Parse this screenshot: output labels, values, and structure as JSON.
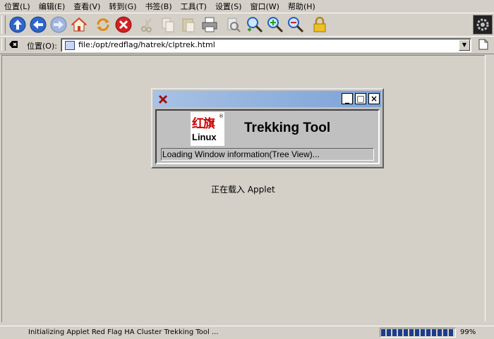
{
  "menu": [
    "位置(L)",
    "编辑(E)",
    "查看(V)",
    "转到(G)",
    "书签(B)",
    "工具(T)",
    "设置(S)",
    "窗口(W)",
    "帮助(H)"
  ],
  "toolbar": {
    "icons": [
      "up-arrow-icon",
      "back-arrow-icon",
      "forward-arrow-icon",
      "home-icon",
      "reload-icon",
      "stop-icon",
      "cut-icon",
      "copy-icon",
      "paste-icon",
      "print-icon",
      "print-preview-icon",
      "zoom-icon",
      "zoom-in-icon",
      "zoom-out-icon",
      "lock-icon"
    ]
  },
  "location": {
    "label": "位置(O):",
    "url": "file:/opt/redflag/hatrek/clptrek.html"
  },
  "splash": {
    "logo_cn": "红旗",
    "logo_reg": "®",
    "logo_linux": "Linux",
    "app_title": "Trekking Tool",
    "status": "Loading Window information(Tree View)...",
    "buttons": {
      "minimize": "_",
      "maximize": "□",
      "close": "×"
    }
  },
  "content": {
    "loading_message": "正在载入  Applet"
  },
  "statusbar": {
    "text": "Initializing Applet Red Flag HA Cluster Trekking Tool ...",
    "progress_percent": 99,
    "progress_label": "99%"
  },
  "colors": {
    "chrome": "#d4d0c8",
    "titlebar_start": "#a7c2e4",
    "titlebar_end": "#7ca2d6",
    "progress_fill": "#1c3d8e",
    "logo_red": "#cc0000"
  }
}
